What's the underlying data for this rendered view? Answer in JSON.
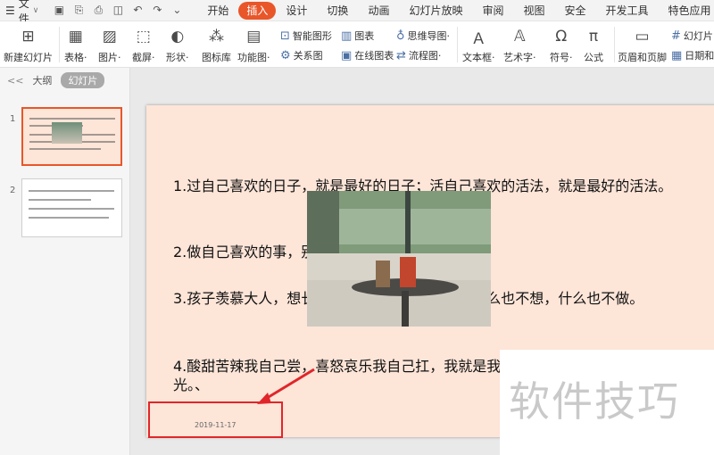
{
  "menubar": {
    "file_label": "文件",
    "tabs": [
      "开始",
      "插入",
      "设计",
      "切换",
      "动画",
      "幻灯片放映",
      "审阅",
      "视图",
      "安全",
      "开发工具",
      "特色应用"
    ],
    "active_tab": "插入"
  },
  "ribbon": {
    "new_slide": "新建幻灯片",
    "table": "表格·",
    "picture": "图片·",
    "screenshot": "截屏·",
    "shape": "形状·",
    "icon_lib": "图标库",
    "function_chart": "功能图·",
    "smart_shape": "智能图形",
    "chart": "图表",
    "relation": "关系图",
    "online_chart": "在线图表",
    "mindmap": "思维导图·",
    "flowchart": "流程图·",
    "textbox": "文本框·",
    "wordart": "艺术字·",
    "symbol": "符号·",
    "formula": "公式",
    "header_footer": "页眉和页脚",
    "slide_number": "幻灯片",
    "date": "日期和"
  },
  "panel": {
    "collapse": "<<",
    "outline": "大纲",
    "slides": "幻灯片",
    "thumbs": [
      {
        "num": "1"
      },
      {
        "num": "2"
      }
    ]
  },
  "slide": {
    "items": [
      "1.过自己喜欢的日子，就是最好的日子；活自己喜欢的活法，就是最好的活法。",
      "2.做自己喜欢的事，别想太多，别期待太多。",
      "3.孩子羡慕大人，想长大，大人羡慕孩子，可以什么也不想，什么也不做。",
      "4.酸甜苦辣我自己尝，喜怒哀乐我自己扛，我就是我自己的光，不必成为谁的光。、"
    ],
    "date": "2019-11-17"
  },
  "watermark": "软件技巧",
  "colors": {
    "accent": "#e8562a",
    "slide_bg": "#fde5d8",
    "highlight": "#e0262b"
  }
}
